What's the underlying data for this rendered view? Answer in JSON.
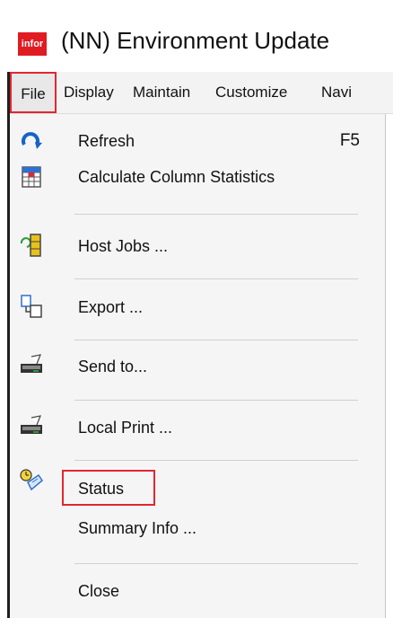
{
  "window": {
    "title": "(NN) Environment Update",
    "logo_text": "infor"
  },
  "menubar": {
    "items": [
      {
        "label": "File"
      },
      {
        "label": "Display"
      },
      {
        "label": "Maintain"
      },
      {
        "label": "Customize"
      },
      {
        "label": "Navi"
      }
    ]
  },
  "file_menu": {
    "items": [
      {
        "label": "Refresh",
        "shortcut": "F5",
        "icon": "refresh-icon"
      },
      {
        "label": "Calculate Column Statistics",
        "icon": "spreadsheet-icon"
      },
      {
        "label": "Host Jobs ...",
        "icon": "host-jobs-icon"
      },
      {
        "label": "Export ...",
        "icon": "export-icon"
      },
      {
        "label": "Send to...",
        "icon": "printer-icon"
      },
      {
        "label": "Local Print ...",
        "icon": "printer-icon"
      },
      {
        "label": "Status",
        "icon": "status-clock-icon"
      },
      {
        "label": "Summary Info ..."
      },
      {
        "label": "Close"
      }
    ]
  },
  "colors": {
    "highlight": "#e3262f",
    "logo": "#e11b22",
    "menu_bg": "#f5f5f5"
  }
}
